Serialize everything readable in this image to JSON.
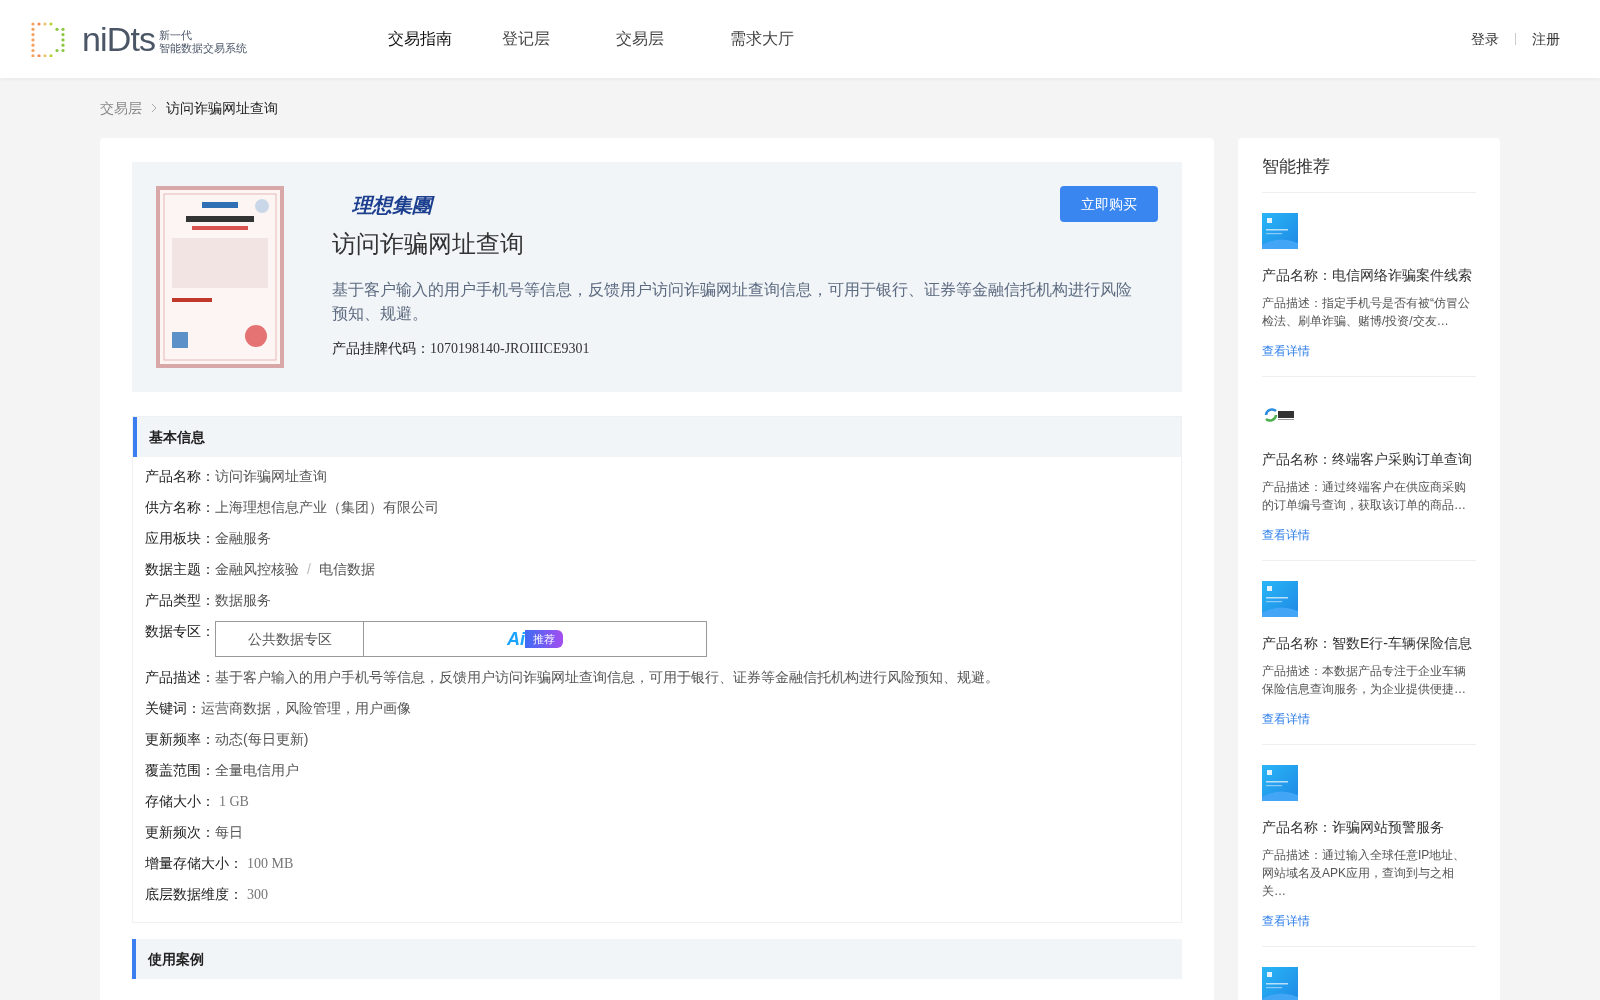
{
  "header": {
    "logo": {
      "wordmark": "niDts",
      "tagline_top": "新一代",
      "tagline_bottom": "智能数据交易系统"
    },
    "nav": [
      {
        "label": "交易指南",
        "selected": true
      },
      {
        "label": "登记层",
        "selected": false
      },
      {
        "label": "交易层",
        "selected": false
      },
      {
        "label": "需求大厅",
        "selected": false
      }
    ],
    "account": [
      "登录",
      "注册"
    ]
  },
  "breadcrumb": [
    "交易层",
    "访问诈骗网址查询"
  ],
  "product": {
    "brand_logo": "理想集團",
    "title": "访问诈骗网址查询",
    "summary": "基于客户输入的用户手机号等信息，反馈用户访问诈骗网址查询信息，可用于银行、证券等金融信托机构进行风险预知、规避。",
    "code_label": "产品挂牌代码：",
    "code": "1070198140-JROIIICE9301",
    "buy_button": "立即购买"
  },
  "basic_info": {
    "title": "基本信息",
    "fields": [
      {
        "kind": "text",
        "label": "产品名称：",
        "value": "访问诈骗网址查询"
      },
      {
        "kind": "text",
        "label": "供方名称：",
        "value": "上海理想信息产业（集团）有限公司"
      },
      {
        "kind": "text",
        "label": "应用板块：",
        "value": "金融服务"
      },
      {
        "kind": "topics",
        "label": "数据主题：",
        "values": [
          "金融风控核验",
          "电信数据"
        ],
        "separator": "/"
      },
      {
        "kind": "text",
        "label": "产品类型：",
        "value": "数据服务"
      },
      {
        "kind": "zones",
        "label": "数据专区：",
        "zone": "公共数据专区",
        "badge": {
          "logo": "Ai",
          "label": "推荐"
        }
      },
      {
        "kind": "text",
        "label": "产品描述：",
        "value": "基于客户输入的用户手机号等信息，反馈用户访问诈骗网址查询信息，可用于银行、证券等金融信托机构进行风险预知、规避。"
      },
      {
        "kind": "text",
        "label": "关键词：",
        "value": "运营商数据，风险管理，用户画像"
      },
      {
        "kind": "text",
        "label": "更新频率：",
        "value": "动态(每日更新)"
      },
      {
        "kind": "text",
        "label": "覆盖范围：",
        "value": "全量电信用户"
      },
      {
        "kind": "measure",
        "label": "存储大小：",
        "value": "1 GB"
      },
      {
        "kind": "text",
        "label": "更新频次：",
        "value": "每日"
      },
      {
        "kind": "measure",
        "label": "增量存储大小：",
        "value": "100 MB"
      },
      {
        "kind": "measure",
        "label": "底层数据维度：",
        "value": "300"
      }
    ]
  },
  "next_section": {
    "title": "使用案例"
  },
  "recommendations": {
    "title": "智能推荐",
    "items": [
      {
        "kind": "card",
        "name": "产品名称：电信网络诈骗案件线索",
        "description": "产品描述：指定手机号是否有被“仿冒公检法、刷单诈骗、赌博/投资/交友…",
        "link": "查看详情"
      },
      {
        "kind": "logo",
        "name": "产品名称：终端客户采购订单查询",
        "description": "产品描述：通过终端客户在供应商采购的订单编号查询，获取该订单的商品…",
        "link": "查看详情"
      },
      {
        "kind": "card",
        "name": "产品名称：智数E行-车辆保险信息",
        "description": "产品描述：本数据产品专注于企业车辆保险信息查询服务，为企业提供便捷…",
        "link": "查看详情"
      },
      {
        "kind": "card",
        "name": "产品名称：诈骗网站预警服务",
        "description": "产品描述：通过输入全球任意IP地址、网站域名及APK应用，查询到与之相关…",
        "link": "查看详情"
      },
      {
        "kind": "card"
      }
    ]
  }
}
